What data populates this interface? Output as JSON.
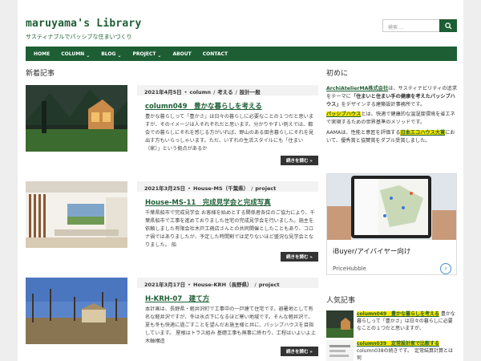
{
  "header": {
    "site_title": "maruyama's Library",
    "site_desc": "サスティナブルでパッシブな住まいづくり",
    "search_placeholder": "検索 …"
  },
  "nav": [
    {
      "label": "HOME",
      "dropdown": false
    },
    {
      "label": "COLUMN",
      "dropdown": true
    },
    {
      "label": "BLOG",
      "dropdown": true
    },
    {
      "label": "PROJECT",
      "dropdown": true
    },
    {
      "label": "ABOUT",
      "dropdown": false
    },
    {
      "label": "CONTACT",
      "dropdown": false
    }
  ],
  "main": {
    "heading": "新着記事",
    "posts": [
      {
        "date": "2021年4月5日",
        "cat1": "column",
        "cat2": "考える",
        "cat3": "設計一般",
        "title": "column049　豊かな暮らしを考える",
        "excerpt": "豊かな暮らしって「豊かさ」は日々の暮らしに必要なことの１つだと思いますが、そのイメージは人それぞれだと思います。分かりやすい例えでは、都会での暮らしにそれを感じる方がいれば、野山のある田舎暮らしにそれを見出す方もいらっしゃいます。ただ、いずれの生活スタイルにも「住まい（家）」という拠点があるか",
        "more": "続きを読む »"
      },
      {
        "date": "2021年3月25日",
        "cat1": "House-MS（千葉県）",
        "cat2": "project",
        "cat3": "",
        "title": "House-MS-11　完成見学会と完成写真",
        "excerpt": "千葉県船市で完成見学会 お客様を始めとする関係者各位のご協力により、千葉県船市で工事を進めておりました住宅の完成見学会を行いました。施主を依頼しました有限会社木戸工務店さんとの共同開催としたこともあり、コロナ禍ではありましたが、予定した時間割では足りないほど盛況な見学会となりました。 船",
        "more": "続きを読む »"
      },
      {
        "date": "2021年3月17日",
        "cat1": "House-KRH（長野県）",
        "cat2": "project",
        "cat3": "",
        "title": "H-KRH-07　建て方",
        "excerpt": "本計画は、長野県・軽井沢町で工事中の一戸建て住宅です。避暑地として有名な軽井沢ですが、冬は氷点下になるほど寒い地域です。そんな軽井沢で、夏も冬も快適に過ごすことを望んだお施主様と共に、パッシブハウスを目指しています。 屋根はトラス組み 基礎工事も無事に終わり、工程はいよいよ上木軸構造",
        "more": "続きを読む »"
      }
    ]
  },
  "sidebar": {
    "intro_heading": "初めに",
    "intro_p1_link": "ArchiAtelierMA株式会社",
    "intro_p1_text": "は、サスティナビリティの追求をテーマに",
    "intro_p1_bold": "「住まいと住まい手の健康を考えたパッシブハウス」",
    "intro_p1_tail": "をデザインする建築設計事務所です。",
    "intro_p2_link": "パッシブハウス",
    "intro_p2_text": "とは、快適で健康的な温湿度環境を省エネで実現するための世界基準のメソッドです。",
    "intro_p3_head": "AAMAは、性能と意匠を評価する",
    "intro_p3_link": "日本エコハウス大賞",
    "intro_p3_tail": "において、優秀賞と協賛賞をダブル受賞しました。",
    "ad_title": "iBuyer/アイバイヤー向け",
    "ad_brand": "PriceHubble",
    "popular_heading": "人気記事",
    "popular": [
      {
        "title": "column049　豊かな暮らしを考える",
        "text": "豊かな暮らしって「豊かさ」は日々の暮らしに必要なことの１つだと思いますが、"
      },
      {
        "title": "column039　定常設計家で比較する",
        "text": "column038の続きです。　定常結算計算とは何"
      }
    ]
  },
  "colors": {
    "brand": "#1d5e34",
    "highlight": "#f5e400",
    "button": "#333333"
  }
}
